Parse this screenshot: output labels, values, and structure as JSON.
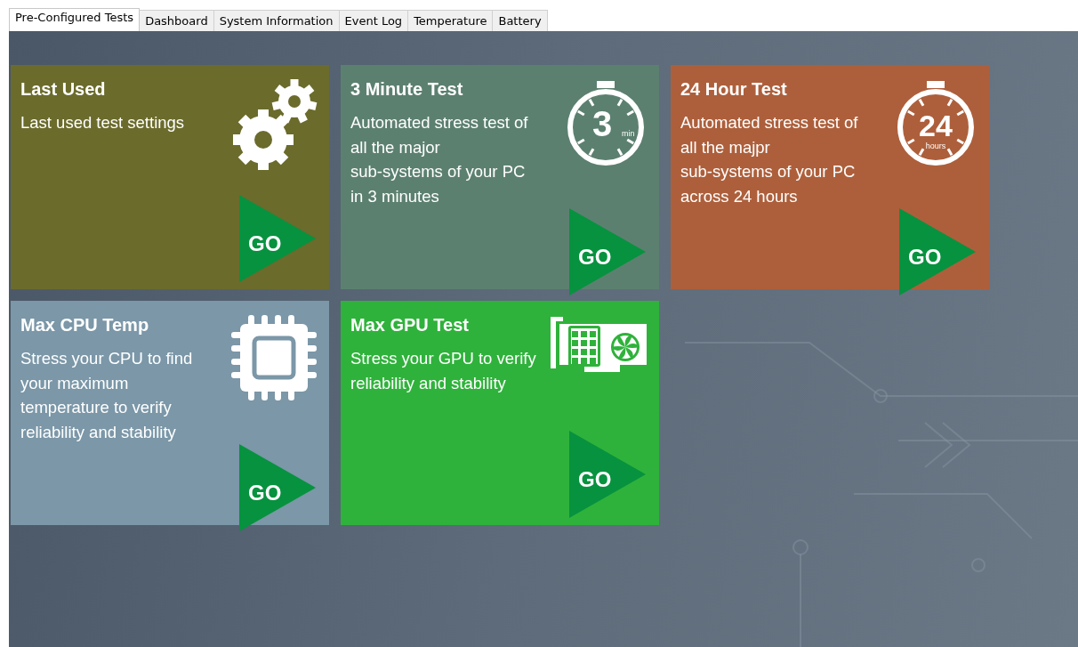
{
  "tabs": [
    {
      "label": "Pre-Configured Tests",
      "selected": true
    },
    {
      "label": "Dashboard",
      "selected": false
    },
    {
      "label": "System Information",
      "selected": false
    },
    {
      "label": "Event Log",
      "selected": false
    },
    {
      "label": "Temperature",
      "selected": false
    },
    {
      "label": "Battery",
      "selected": false
    }
  ],
  "tiles": [
    {
      "title": "Last Used",
      "description": "Last used test settings",
      "color": "#6b6b2c",
      "kind": "gears",
      "button": "GO"
    },
    {
      "title": "3 Minute Test",
      "description": "Automated stress test of\nall the major\nsub-systems of your PC\nin 3 minutes",
      "color": "#5c8070",
      "kind": "timer",
      "icon_number": "3",
      "icon_unit": "min",
      "button": "GO"
    },
    {
      "title": "24 Hour Test",
      "description": "Automated stress test of\nall the majpr\nsub-systems of your PC\nacross 24 hours",
      "color": "#ad5f3b",
      "kind": "timer",
      "icon_number": "24",
      "icon_unit": "hours",
      "button": "GO"
    },
    {
      "title": "Max CPU Temp",
      "description": "Stress your CPU to find\nyour maximum\ntemperature to verify\nreliability and stability",
      "color": "#7b97a8",
      "kind": "cpu",
      "button": "GO"
    },
    {
      "title": "Max GPU Test",
      "description": "Stress your GPU to verify\nreliability and stability",
      "color": "#2fb23b",
      "kind": "gpu",
      "button": "GO"
    }
  ]
}
